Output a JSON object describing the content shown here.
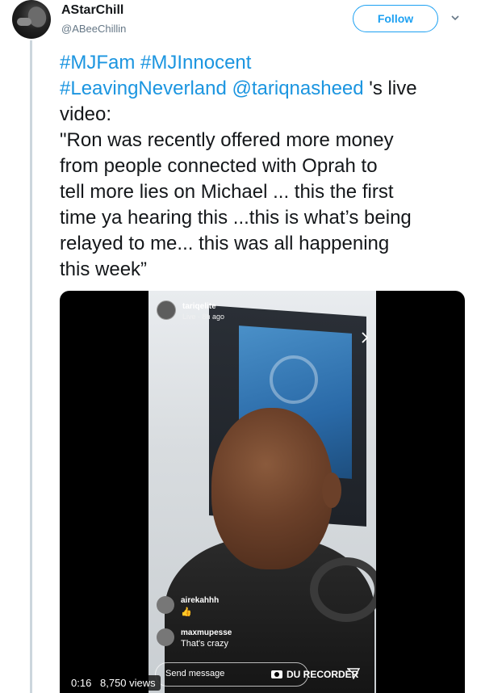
{
  "author": {
    "display_name": "AStarChill",
    "handle": "@ABeeChillin"
  },
  "actions": {
    "follow_label": "Follow",
    "more_icon": "chevron-down-icon"
  },
  "tweet": {
    "hashtag_1": "#MJFam",
    "hashtag_2": "#MJInnocent",
    "hashtag_3": "#LeavingNeverland",
    "mention": "@tariqnasheed",
    "line_2_suffix": " 's live",
    "line_3": "video:",
    "line_4": "\"Ron was recently offered more money",
    "line_5": "from people connected with Oprah to",
    "line_6": "tell more lies on Michael ... this the first",
    "line_7": "time ya hearing this ...this is what’s being",
    "line_8": "relayed to me... this was all happening",
    "line_9": "this week”"
  },
  "video": {
    "live_user": "tariqelite",
    "live_meta": "Live · 8h ago",
    "comments": [
      {
        "name": "airekahhh",
        "text": "👍"
      },
      {
        "name": "maxmupesse",
        "text": "That's crazy"
      }
    ],
    "send_placeholder": "Send message",
    "recorder_label": "DU RECORDER",
    "time": "0:16",
    "views": "8,750 views"
  },
  "colors": {
    "link": "#1b95e0",
    "follow": "#1da1f2",
    "thread_line": "#ccd6dd"
  }
}
